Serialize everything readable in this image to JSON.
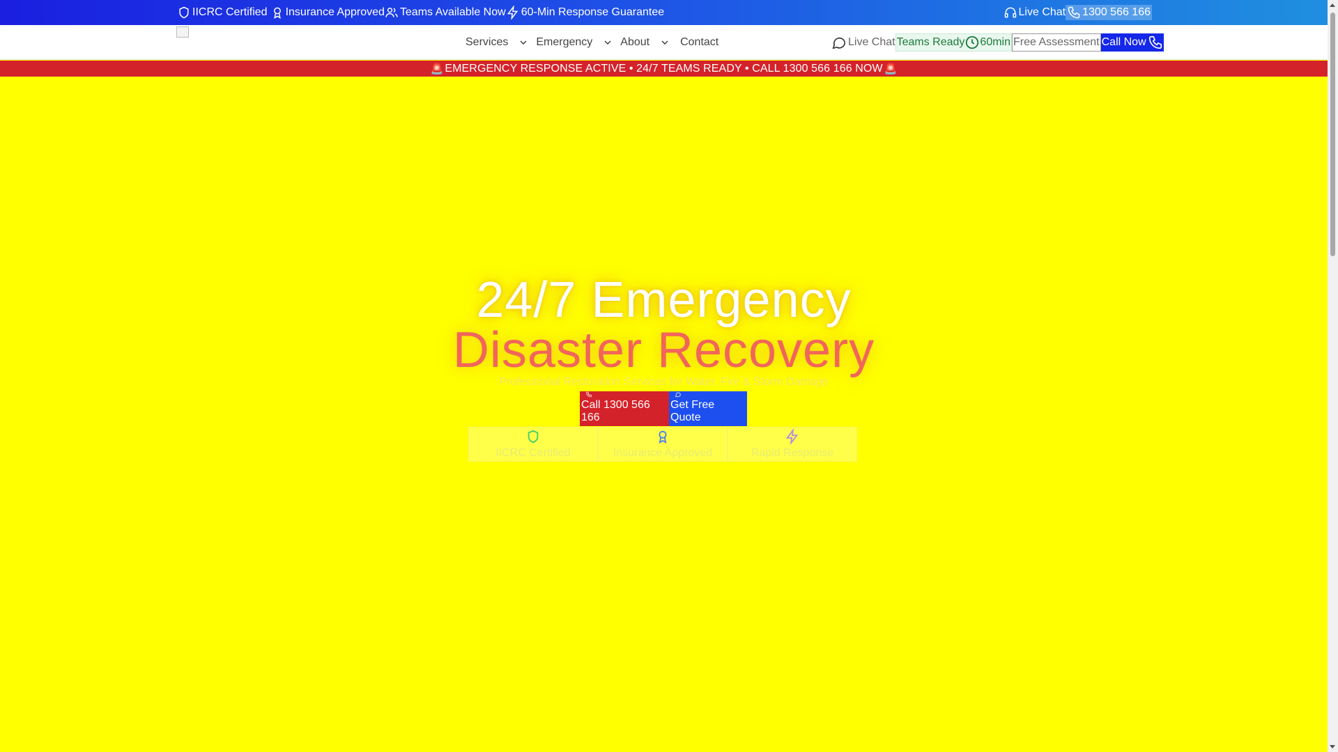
{
  "topbar": {
    "items": [
      {
        "icon": "shield-icon",
        "label": "IICRC Certified"
      },
      {
        "icon": "award-icon",
        "label": "Insurance Approved"
      },
      {
        "icon": "users-icon",
        "label": "Teams Available Now"
      },
      {
        "icon": "lightning-icon",
        "label": "60-Min Response Guarantee"
      }
    ],
    "live_chat": "Live Chat",
    "phone": "1300 566 166"
  },
  "nav": {
    "menu": [
      "Services",
      "Emergency",
      "About",
      "Contact"
    ],
    "live_chat": "Live Chat",
    "teams_ready": "Teams Ready",
    "response_time": "60min",
    "free_assessment": "Free Assessment",
    "call_now": "Call Now"
  },
  "emergency_bar": {
    "text": "EMERGENCY RESPONSE ACTIVE • 24/7 TEAMS READY • CALL 1300 566 166 NOW"
  },
  "hero": {
    "title_line1": "24/7 Emergency",
    "title_line2": "Disaster Recovery",
    "subtitle": "Professional Restoration Services for Water, Fire & Storm Damage",
    "cta_call": "Call 1300 566 166",
    "cta_quote": "Get Free Quote",
    "badges": [
      {
        "icon": "shield-icon",
        "label": "IICRC Certified"
      },
      {
        "icon": "award-icon",
        "label": "Insurance Approved"
      },
      {
        "icon": "lightning-icon",
        "label": "Rapid Response"
      }
    ]
  },
  "colors": {
    "hero_bg": "#ffff00",
    "emergency_red": "#d4222a",
    "primary_blue": "#1527e8",
    "accent_coral": "#f2655a"
  }
}
